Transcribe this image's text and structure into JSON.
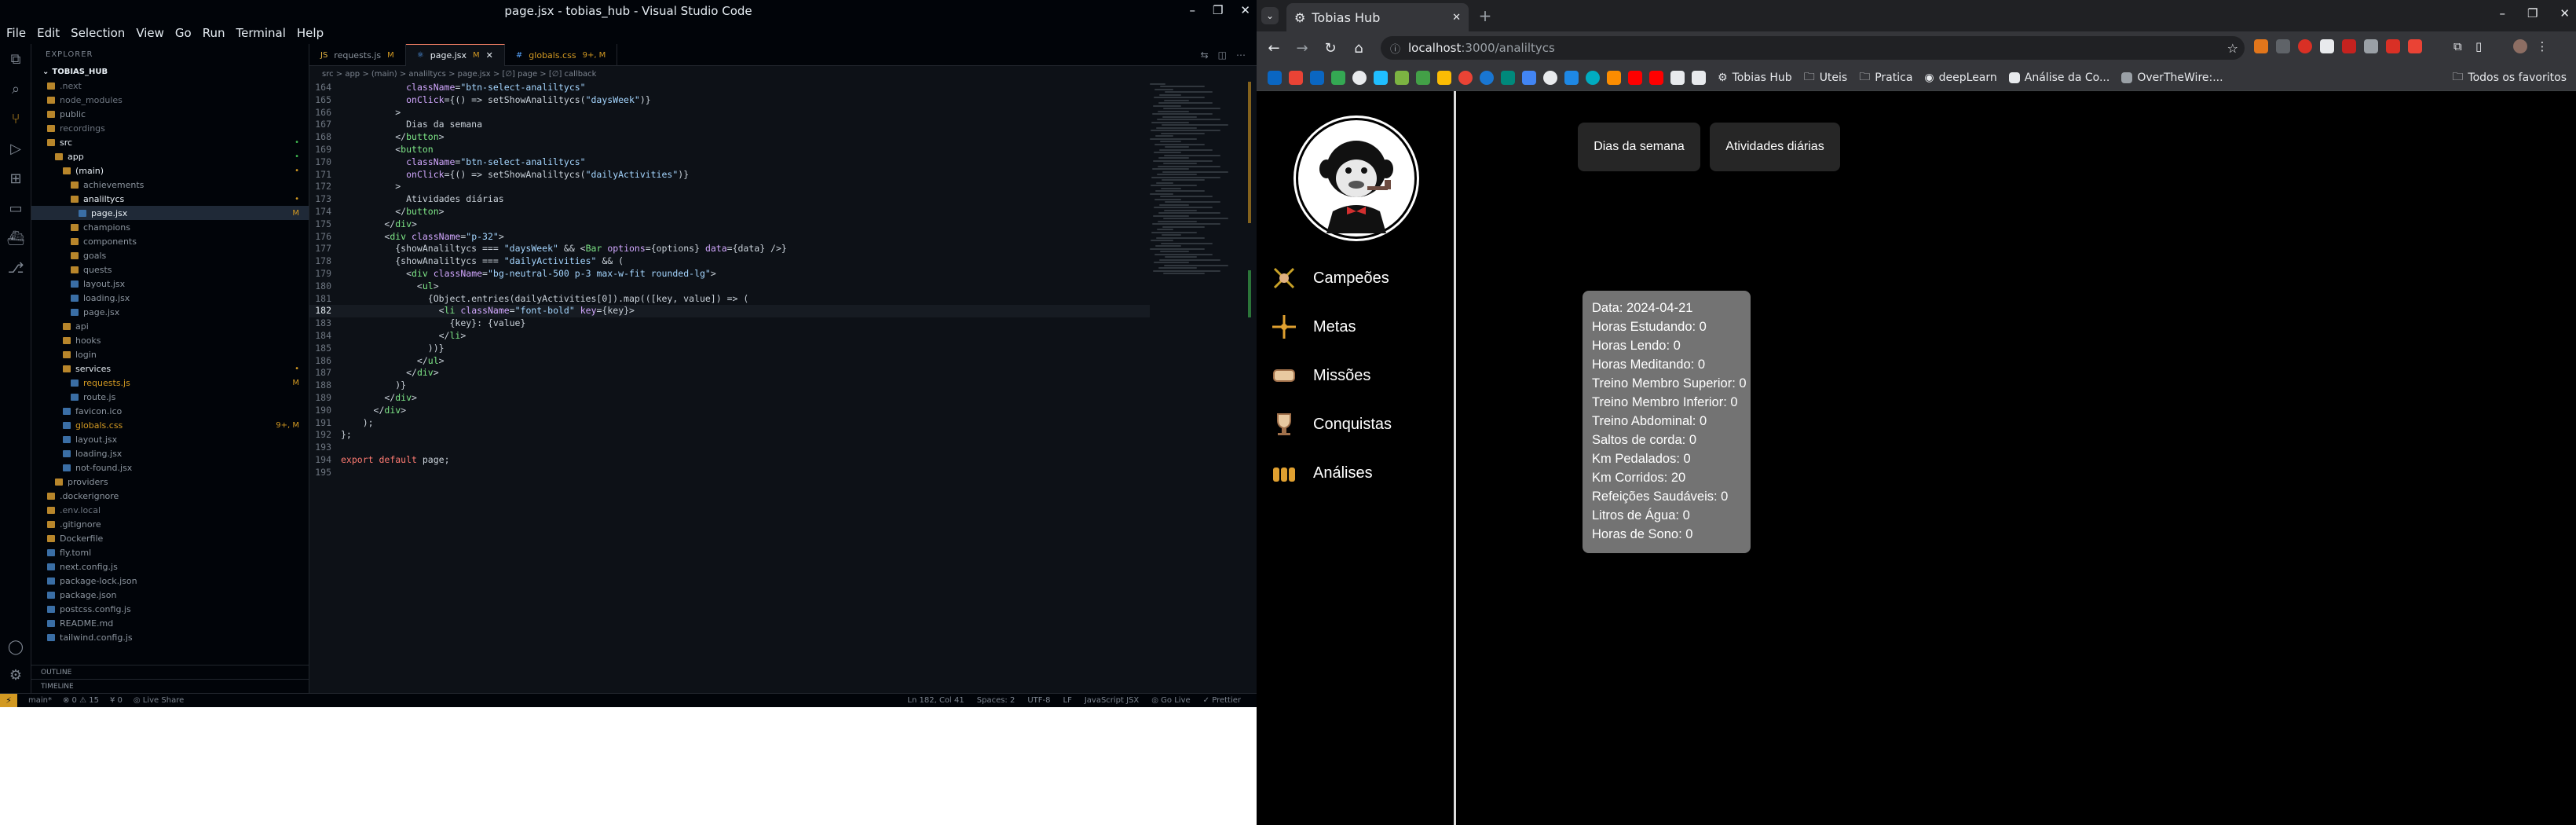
{
  "vscode": {
    "window_title": "page.jsx - tobias_hub - Visual Studio Code",
    "menu": [
      "File",
      "Edit",
      "Selection",
      "View",
      "Go",
      "Run",
      "Terminal",
      "Help"
    ],
    "explorer_title": "EXPLORER",
    "workspace": "TOBIAS_HUB",
    "tree": [
      {
        "label": ".next",
        "indent": 1,
        "color": "#6e7681"
      },
      {
        "label": "node_modules",
        "indent": 1,
        "color": "#6e7681"
      },
      {
        "label": "public",
        "indent": 1,
        "color": "#8b949e"
      },
      {
        "label": "recordings",
        "indent": 1,
        "color": "#6e7681"
      },
      {
        "label": "src",
        "indent": 1,
        "color": "#e6edf3",
        "badge": "•",
        "badge_color": "#3fb950"
      },
      {
        "label": "app",
        "indent": 2,
        "color": "#e6edf3",
        "badge": "•",
        "badge_color": "#3fb950"
      },
      {
        "label": "(main)",
        "indent": 3,
        "color": "#e6edf3",
        "badge": "•",
        "badge_color": "#d29922"
      },
      {
        "label": "achievements",
        "indent": 4,
        "color": "#8b949e"
      },
      {
        "label": "analiltycs",
        "indent": 4,
        "color": "#e6edf3",
        "badge": "•",
        "badge_color": "#d29922"
      },
      {
        "label": "page.jsx",
        "indent": 5,
        "color": "#e6edf3",
        "badge": "M",
        "badge_color": "#d29922",
        "active": true
      },
      {
        "label": "champions",
        "indent": 4,
        "color": "#8b949e"
      },
      {
        "label": "components",
        "indent": 4,
        "color": "#8b949e"
      },
      {
        "label": "goals",
        "indent": 4,
        "color": "#8b949e"
      },
      {
        "label": "quests",
        "indent": 4,
        "color": "#8b949e"
      },
      {
        "label": "layout.jsx",
        "indent": 4,
        "color": "#8b949e"
      },
      {
        "label": "loading.jsx",
        "indent": 4,
        "color": "#8b949e"
      },
      {
        "label": "page.jsx",
        "indent": 4,
        "color": "#8b949e"
      },
      {
        "label": "api",
        "indent": 3,
        "color": "#8b949e"
      },
      {
        "label": "hooks",
        "indent": 3,
        "color": "#8b949e"
      },
      {
        "label": "login",
        "indent": 3,
        "color": "#8b949e"
      },
      {
        "label": "services",
        "indent": 3,
        "color": "#e6edf3",
        "badge": "•",
        "badge_color": "#d29922"
      },
      {
        "label": "requests.js",
        "indent": 4,
        "color": "#d29922",
        "badge": "M",
        "badge_color": "#d29922"
      },
      {
        "label": "route.js",
        "indent": 4,
        "color": "#8b949e"
      },
      {
        "label": "favicon.ico",
        "indent": 3,
        "color": "#8b949e"
      },
      {
        "label": "globals.css",
        "indent": 3,
        "color": "#d29922",
        "badge": "9+, M",
        "badge_color": "#d29922"
      },
      {
        "label": "layout.jsx",
        "indent": 3,
        "color": "#8b949e"
      },
      {
        "label": "loading.jsx",
        "indent": 3,
        "color": "#8b949e"
      },
      {
        "label": "not-found.jsx",
        "indent": 3,
        "color": "#8b949e"
      },
      {
        "label": "providers",
        "indent": 2,
        "color": "#8b949e"
      },
      {
        "label": ".dockerignore",
        "indent": 1,
        "color": "#8b949e"
      },
      {
        "label": ".env.local",
        "indent": 1,
        "color": "#6e7681"
      },
      {
        "label": ".gitignore",
        "indent": 1,
        "color": "#8b949e"
      },
      {
        "label": "Dockerfile",
        "indent": 1,
        "color": "#8b949e"
      },
      {
        "label": "fly.toml",
        "indent": 1,
        "color": "#8b949e"
      },
      {
        "label": "next.config.js",
        "indent": 1,
        "color": "#8b949e"
      },
      {
        "label": "package-lock.json",
        "indent": 1,
        "color": "#8b949e"
      },
      {
        "label": "package.json",
        "indent": 1,
        "color": "#8b949e"
      },
      {
        "label": "postcss.config.js",
        "indent": 1,
        "color": "#8b949e"
      },
      {
        "label": "README.md",
        "indent": 1,
        "color": "#8b949e"
      },
      {
        "label": "tailwind.config.js",
        "indent": 1,
        "color": "#8b949e"
      }
    ],
    "outline_label": "OUTLINE",
    "timeline_label": "TIMELINE",
    "tabs": [
      {
        "label": "requests.js",
        "mod": "M",
        "active": false
      },
      {
        "label": "page.jsx",
        "mod": "M",
        "active": true
      },
      {
        "label": "globals.css",
        "mod": "9+, M",
        "active": false
      }
    ],
    "breadcrumb": "src > app > (main) > analiltycs > page.jsx > [∅] page > [∅] callback",
    "code": [
      {
        "n": "164",
        "t": "            className=\"btn-select-analiltycs\""
      },
      {
        "n": "165",
        "t": "            onClick={() => setShowAnaliltycs(\"daysWeek\")}"
      },
      {
        "n": "166",
        "t": "          >"
      },
      {
        "n": "167",
        "t": "            Dias da semana"
      },
      {
        "n": "168",
        "t": "          </button>"
      },
      {
        "n": "169",
        "t": "          <button"
      },
      {
        "n": "170",
        "t": "            className=\"btn-select-analiltycs\""
      },
      {
        "n": "171",
        "t": "            onClick={() => setShowAnaliltycs(\"dailyActivities\")}"
      },
      {
        "n": "172",
        "t": "          >"
      },
      {
        "n": "173",
        "t": "            Atividades diárias"
      },
      {
        "n": "174",
        "t": "          </button>"
      },
      {
        "n": "175",
        "t": "        </div>"
      },
      {
        "n": "176",
        "t": "        <div className=\"p-32\">"
      },
      {
        "n": "177",
        "t": "          {showAnaliltycs === \"daysWeek\" && <Bar options={options} data={data} />}"
      },
      {
        "n": "178",
        "t": "          {showAnaliltycs === \"dailyActivities\" && ("
      },
      {
        "n": "179",
        "t": "            <div className=\"bg-neutral-500 p-3 max-w-fit rounded-lg\">"
      },
      {
        "n": "180",
        "t": "              <ul>"
      },
      {
        "n": "181",
        "t": "                {Object.entries(dailyActivities[0]).map(([key, value]) => ("
      },
      {
        "n": "182",
        "t": "                  <li className=\"font-bold\" key={key}>",
        "cur": true
      },
      {
        "n": "183",
        "t": "                    {key}: {value}"
      },
      {
        "n": "184",
        "t": "                  </li>"
      },
      {
        "n": "185",
        "t": "                ))}"
      },
      {
        "n": "186",
        "t": "              </ul>"
      },
      {
        "n": "187",
        "t": "            </div>"
      },
      {
        "n": "188",
        "t": "          )}"
      },
      {
        "n": "189",
        "t": "        </div>"
      },
      {
        "n": "190",
        "t": "      </div>"
      },
      {
        "n": "191",
        "t": "    );"
      },
      {
        "n": "192",
        "t": "};"
      },
      {
        "n": "193",
        "t": ""
      },
      {
        "n": "194",
        "t": "export default page;"
      },
      {
        "n": "195",
        "t": ""
      }
    ],
    "status": {
      "branch": "main*",
      "problems": "⊗ 0 ⚠ 15",
      "ports": "¥ 0",
      "live": "◎ Live Share",
      "position": "Ln 182, Col 41",
      "spaces": "Spaces: 2",
      "encoding": "UTF-8",
      "eol": "LF",
      "language": "JavaScript JSX",
      "golive": "◎ Go Live",
      "prettier": "✓ Prettier"
    }
  },
  "chrome": {
    "tab_title": "Tobias Hub",
    "url_host": "localhost",
    "url_path": ":3000/analiltycs",
    "bookmarks": [
      "Tobias Hub",
      "Uteis",
      "Pratica",
      "deepLearn",
      "Análise da Co...",
      "OverTheWire:..."
    ],
    "all_bookmarks": "Todos os favoritos"
  },
  "app": {
    "nav": [
      "Campeões",
      "Metas",
      "Missões",
      "Conquistas",
      "Análises"
    ],
    "buttons": [
      "Dias da semana",
      "Atividades diárias"
    ],
    "activities": [
      "Data: 2024-04-21",
      "Horas Estudando: 0",
      "Horas Lendo: 0",
      "Horas Meditando: 0",
      "Treino Membro Superior: 0",
      "Treino Membro Inferior: 0",
      "Treino Abdominal: 0",
      "Saltos de corda: 0",
      "Km Pedalados: 0",
      "Km Corridos: 20",
      "Refeições Saudáveis: 0",
      "Litros de Água: 0",
      "Horas de Sono: 0"
    ]
  }
}
